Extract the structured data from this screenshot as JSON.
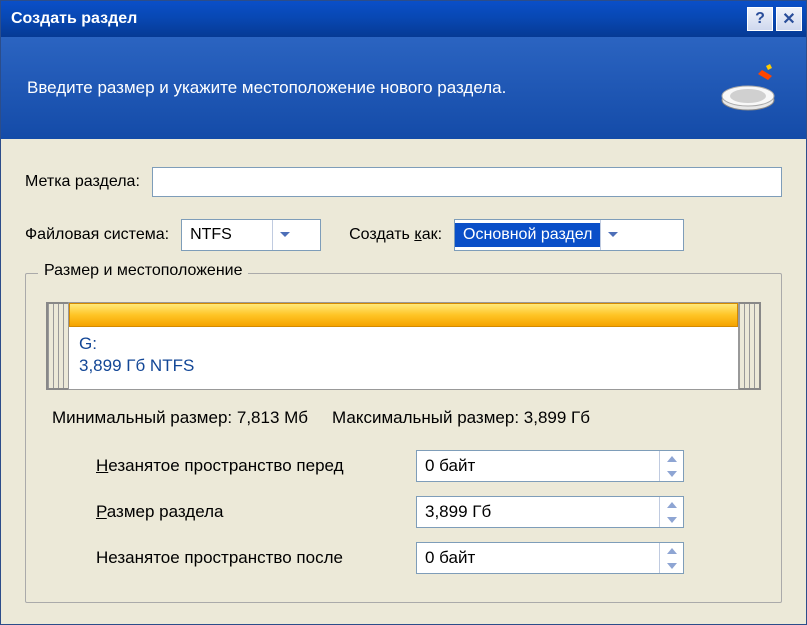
{
  "titlebar": {
    "title": "Создать раздел",
    "help": "?",
    "close": "✕"
  },
  "banner": {
    "text": "Введите размер и укажите местоположение нового раздела."
  },
  "form": {
    "label_field_label": "Метка раздела:",
    "label_value": "",
    "filesystem_label": "Файловая система:",
    "filesystem_value": "NTFS",
    "create_as_prefix": "Создать ",
    "create_as_underline": "к",
    "create_as_suffix": "ак:",
    "create_as_value": "Основной раздел"
  },
  "group": {
    "title": "Размер и местоположение",
    "partition_drive": "G:",
    "partition_desc": "3,899 Гб  NTFS",
    "min_label": "Минимальный размер:",
    "min_value": "7,813 Мб",
    "max_label": "Максимальный размер:",
    "max_value": "3,899 Гб",
    "fields": {
      "before_prefix": "Н",
      "before_rest": "езанятое пространство перед",
      "before_value": "0 байт",
      "size_prefix": "Р",
      "size_rest": "азмер раздела",
      "size_value": "3,899 Гб",
      "after_label": "Незанятое пространство после",
      "after_value": "0 байт"
    }
  }
}
